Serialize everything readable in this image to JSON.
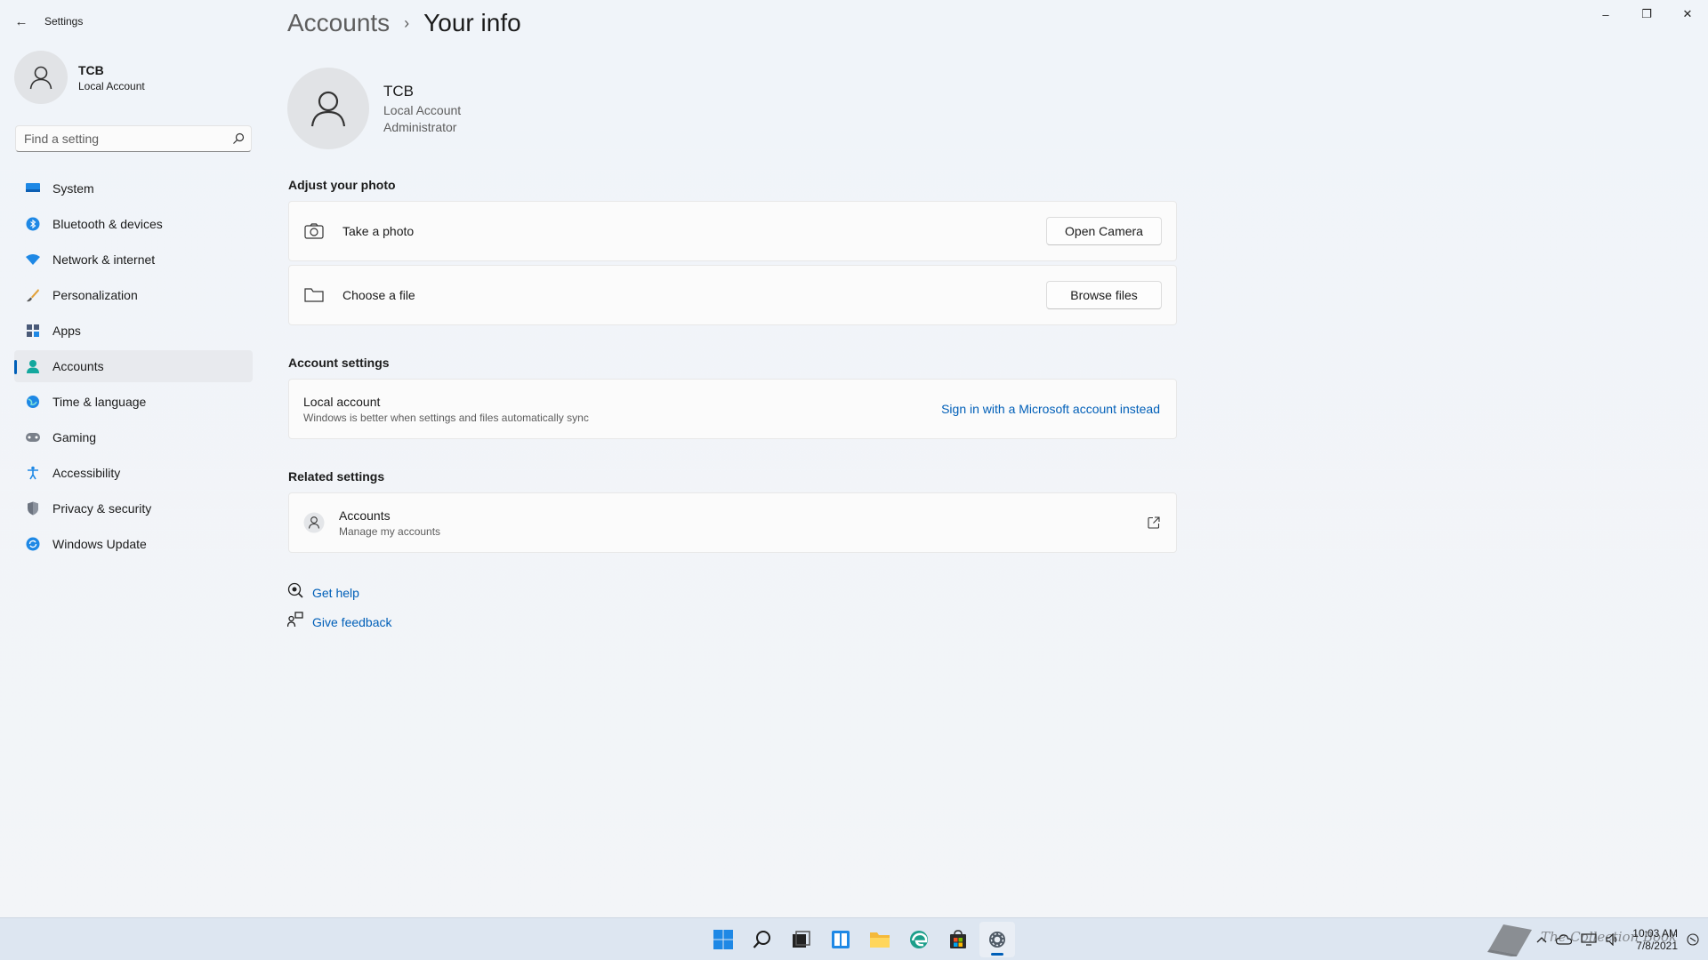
{
  "window": {
    "app_title": "Settings",
    "back_glyph": "←",
    "controls": {
      "minimize": "–",
      "restore": "❐",
      "close": "✕"
    }
  },
  "sidebar": {
    "profile": {
      "name": "TCB",
      "type": "Local Account"
    },
    "search": {
      "placeholder": "Find a setting"
    },
    "items": [
      {
        "label": "System",
        "icon": "system-icon"
      },
      {
        "label": "Bluetooth & devices",
        "icon": "bluetooth-icon"
      },
      {
        "label": "Network & internet",
        "icon": "network-icon"
      },
      {
        "label": "Personalization",
        "icon": "brush-icon"
      },
      {
        "label": "Apps",
        "icon": "apps-icon"
      },
      {
        "label": "Accounts",
        "icon": "accounts-icon",
        "active": true
      },
      {
        "label": "Time & language",
        "icon": "globe-icon"
      },
      {
        "label": "Gaming",
        "icon": "gamepad-icon"
      },
      {
        "label": "Accessibility",
        "icon": "accessibility-icon"
      },
      {
        "label": "Privacy & security",
        "icon": "shield-icon"
      },
      {
        "label": "Windows Update",
        "icon": "update-icon"
      }
    ]
  },
  "main": {
    "breadcrumb": {
      "parent": "Accounts",
      "separator": "›",
      "current": "Your info"
    },
    "user": {
      "name": "TCB",
      "account_type": "Local Account",
      "role": "Administrator"
    },
    "adjust_photo": {
      "title": "Adjust your photo",
      "take_photo": {
        "label": "Take a photo",
        "button": "Open Camera"
      },
      "choose_file": {
        "label": "Choose a file",
        "button": "Browse files"
      }
    },
    "account_settings": {
      "title": "Account settings",
      "local_account": {
        "title": "Local account",
        "subtitle": "Windows is better when settings and files automatically sync",
        "link": "Sign in with a Microsoft account instead"
      }
    },
    "related_settings": {
      "title": "Related settings",
      "accounts": {
        "title": "Accounts",
        "subtitle": "Manage my accounts"
      }
    },
    "help": {
      "get_help": "Get help",
      "give_feedback": "Give feedback"
    }
  },
  "taskbar": {
    "apps": [
      "start-icon",
      "search-icon",
      "task-view-icon",
      "widgets-icon",
      "file-explorer-icon",
      "edge-icon",
      "store-icon",
      "settings-icon"
    ],
    "clock": {
      "time": "10:03 AM",
      "date": "7/8/2021"
    },
    "watermark": "The Collection Book"
  },
  "colors": {
    "accent": "#005fb8",
    "background": "#f3f5f8",
    "card": "#fbfbfb"
  }
}
